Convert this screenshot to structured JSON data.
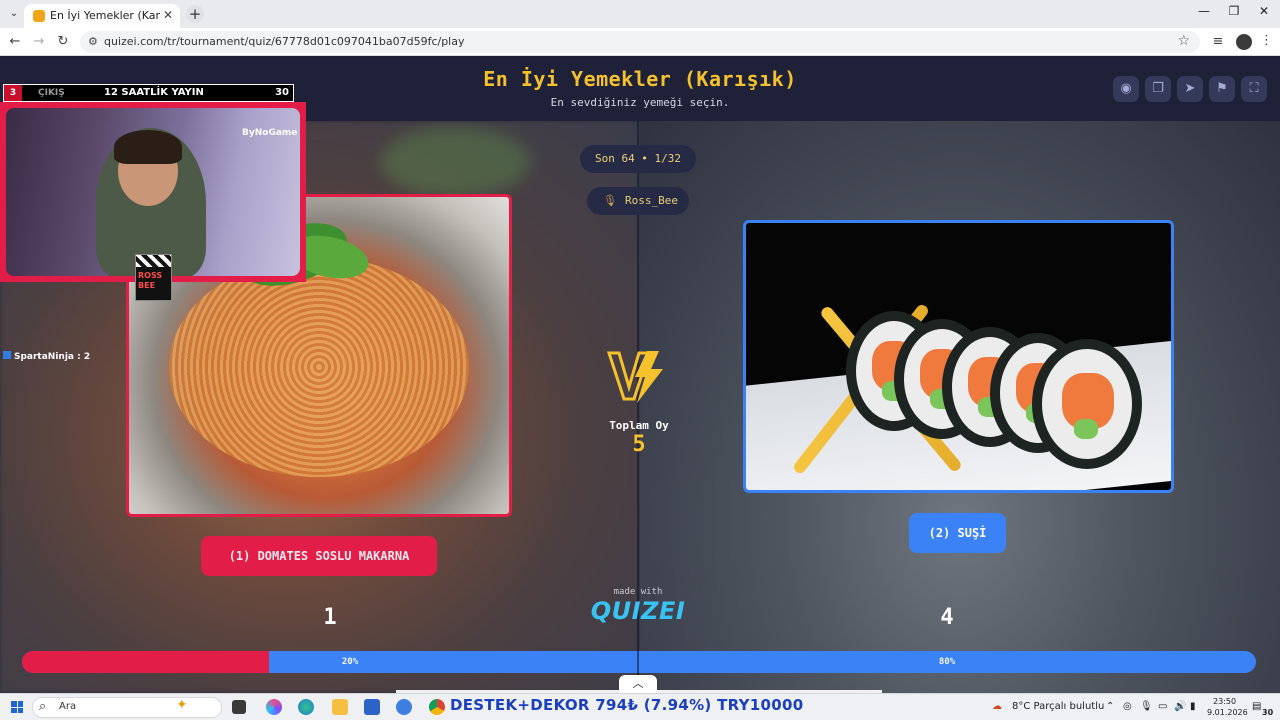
{
  "browser": {
    "tab_title": "En İyi Yemekler (Karışık) - Tier L",
    "url": "quizei.com/tr/tournament/quiz/67778d01c097041ba07d59fc/play"
  },
  "header": {
    "title": "En İyi Yemekler (Karışık)",
    "subtitle": "En sevdiğiniz yemeği seçin."
  },
  "round": {
    "label": "Son 64 • 1/32"
  },
  "player": {
    "name": "Ross_Bee"
  },
  "left_choice": {
    "label": "(1) DOMATES SOSLU MAKARNA",
    "votes": "1",
    "percent_label": "20%",
    "percent": 20
  },
  "right_choice": {
    "label": "(2) SUŞİ",
    "votes": "4",
    "percent_label": "80%",
    "percent": 80
  },
  "totals": {
    "label": "Toplam Oy",
    "value": "5"
  },
  "branding": {
    "made_with": "made with",
    "logo": "QUIZEI"
  },
  "stream_overlay": {
    "left_number": "3",
    "exit_label": "ÇIKIŞ",
    "title": "12 SAATLİK YAYIN",
    "right_number": "30",
    "cam_logo": "ByNoGame",
    "badge": "ROSS BEE",
    "chat_user": "SpartaNinja : 2"
  },
  "taskbar": {
    "search_placeholder": "Ara",
    "ticker": "DESTEK+DEKOR   794₺ (7.94%)        TRY10000",
    "weather": "8°C  Parçalı bulutlu",
    "time": "23:50",
    "date": "9.01.2026",
    "notification_count": "30"
  },
  "colors": {
    "accent_title": "#f6c22b",
    "left_red": "#e11d48",
    "right_blue": "#3b82f6",
    "header_bg": "#1e2138"
  }
}
